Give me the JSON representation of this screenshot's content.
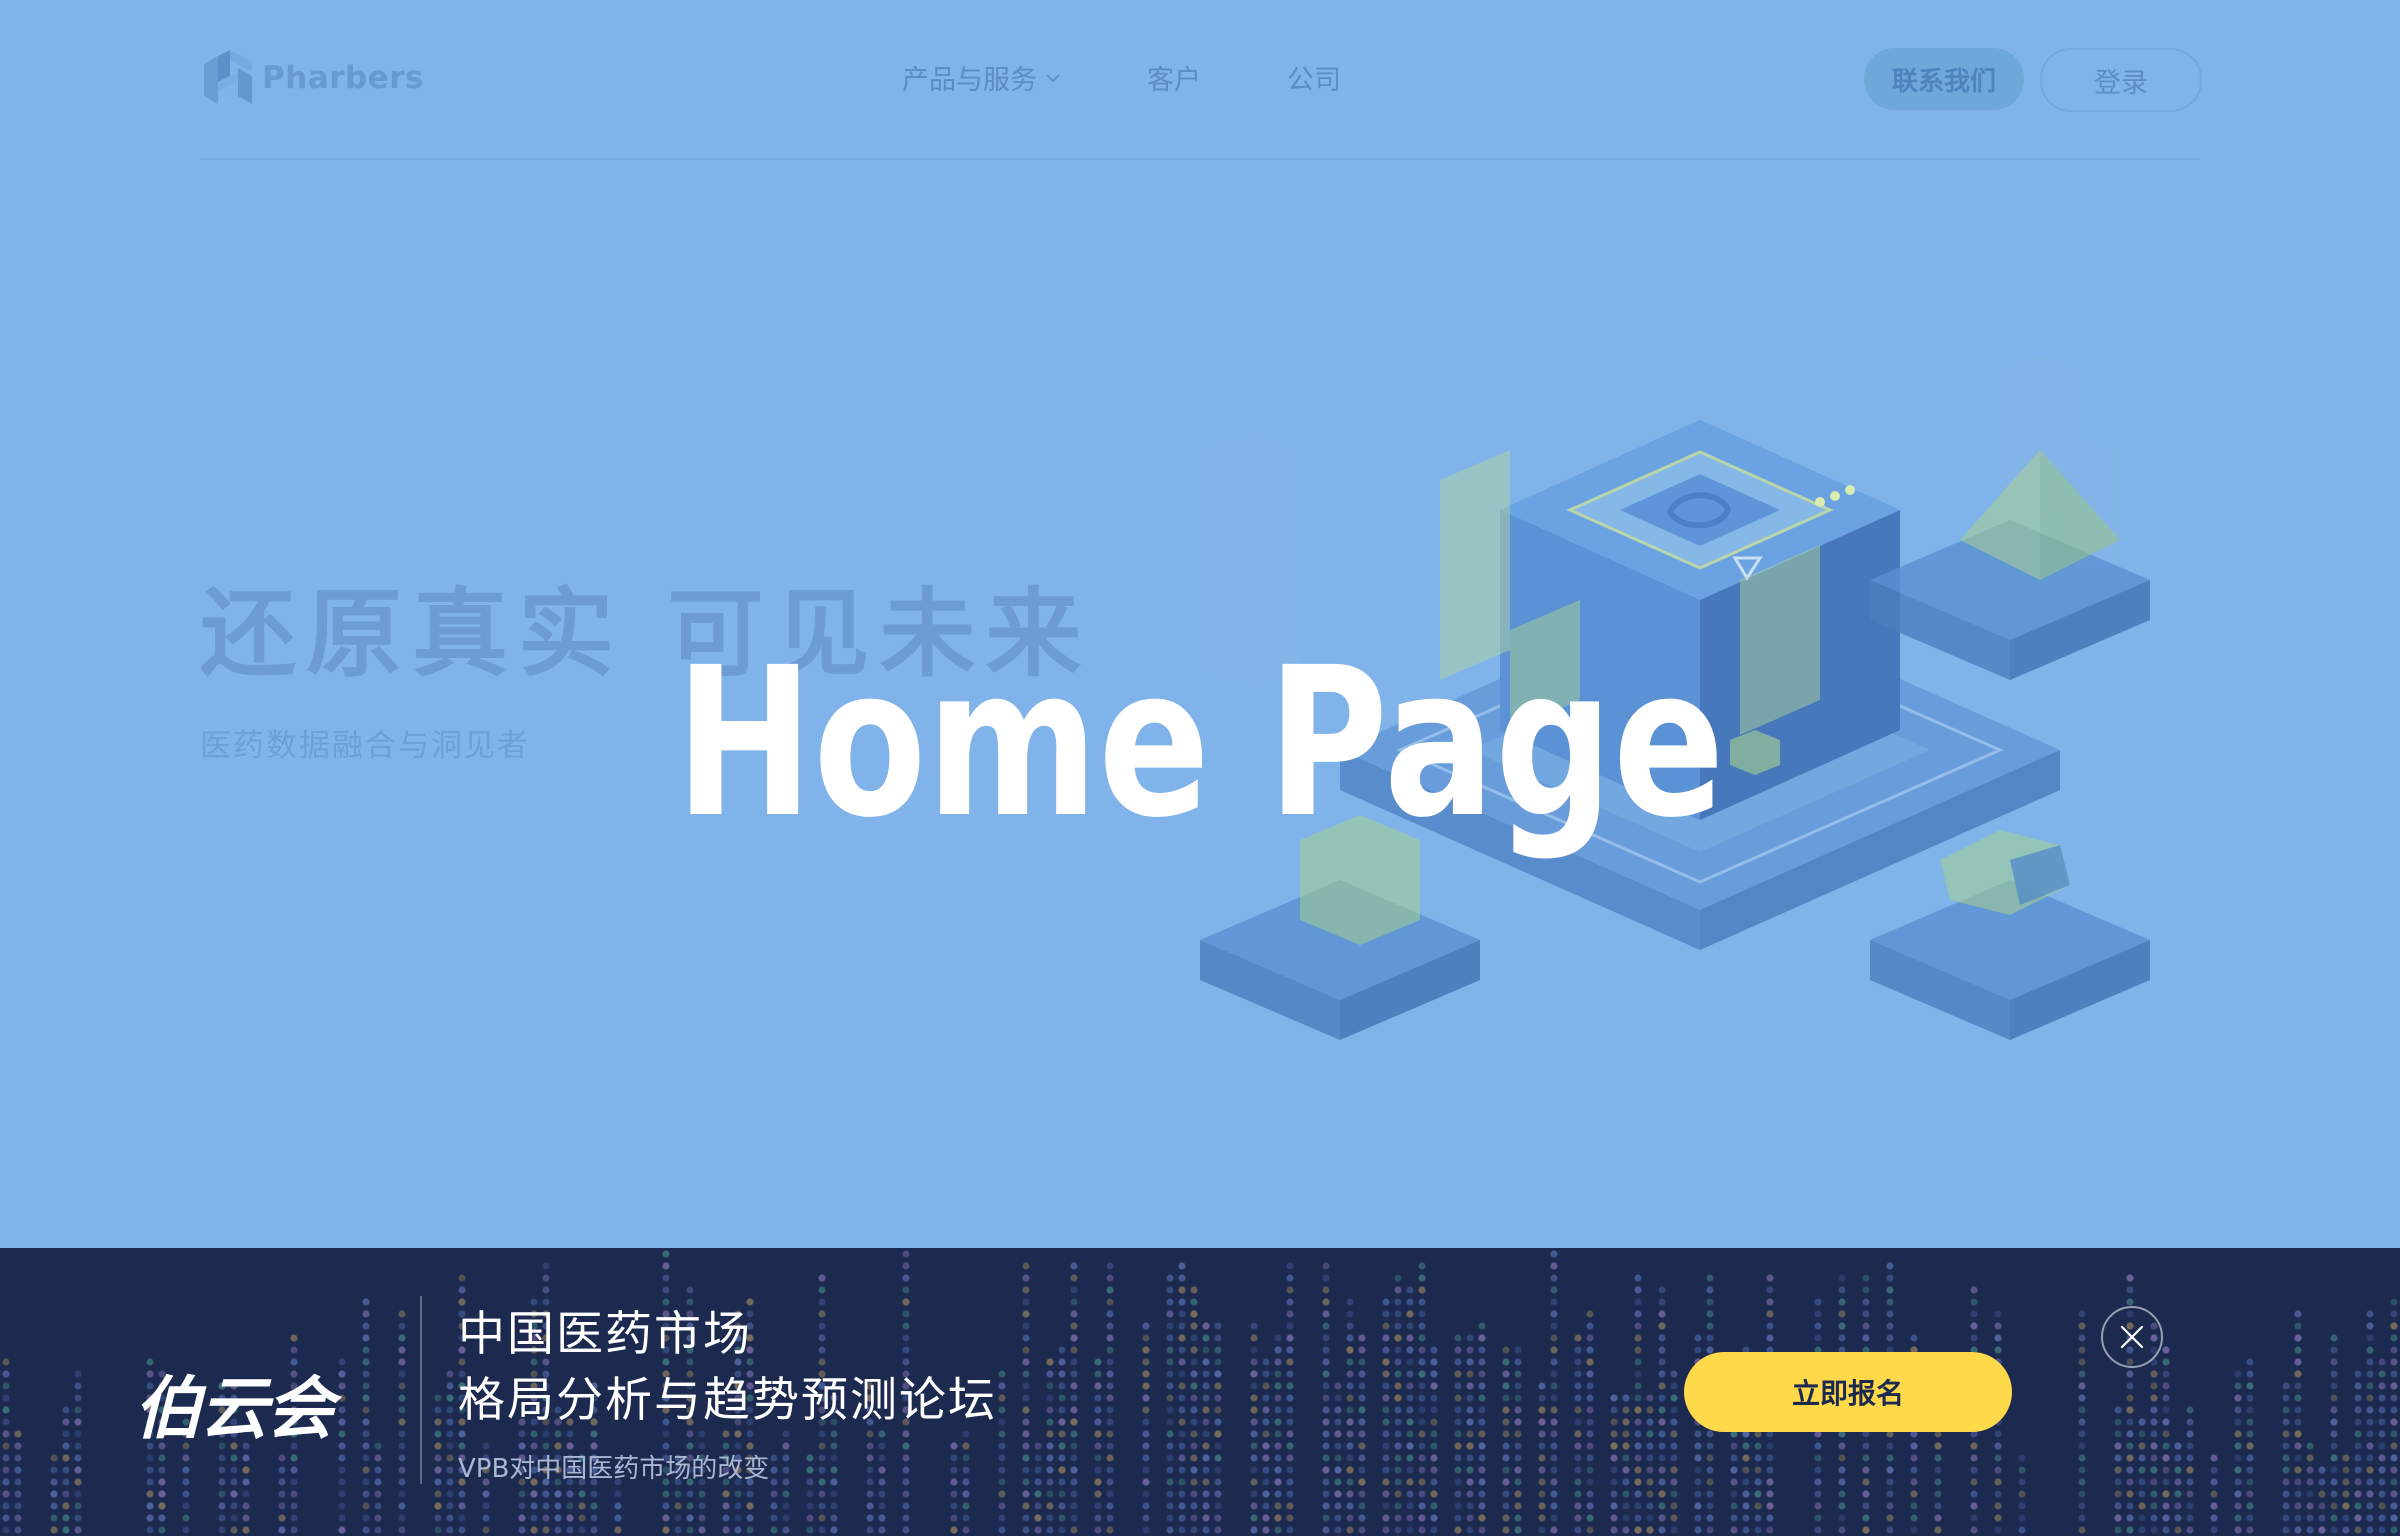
{
  "header": {
    "logo_text": "Pharbers",
    "nav": [
      {
        "label": "产品与服务",
        "has_dropdown": true
      },
      {
        "label": "客户"
      },
      {
        "label": "公司"
      }
    ],
    "contact_label": "联系我们",
    "login_label": "登录"
  },
  "hero": {
    "title": "还原真实  可见未来",
    "subtitle": "医药数据融合与洞见者",
    "illustration": "isometric-data-platform-cube"
  },
  "overlay": {
    "label": "Home Page"
  },
  "banner": {
    "logo_text": "伯云会",
    "title_line1": "中国医药市场",
    "title_line2": "格局分析与趋势预测论坛",
    "subtitle": "VPB对中国医药市场的改变",
    "register_label": "立即报名",
    "close_icon": "close-icon",
    "accent_color": "#ffd94a",
    "background_color": "#1c2a50"
  },
  "colors": {
    "page_background": "#7fb3ea"
  }
}
